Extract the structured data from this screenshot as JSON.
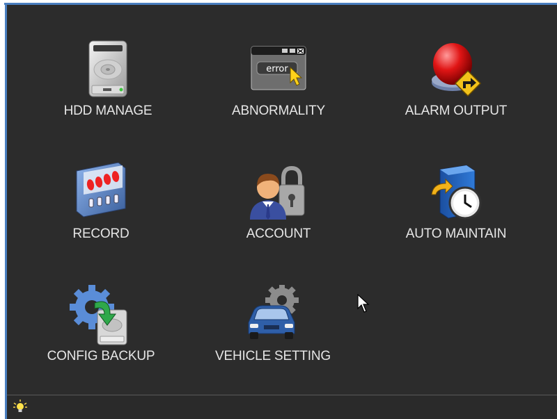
{
  "menu": {
    "items": [
      {
        "label": "HDD MANAGE",
        "icon": "hard-drive-icon"
      },
      {
        "label": "ABNORMALITY",
        "icon": "error-window-icon"
      },
      {
        "label": "ALARM OUTPUT",
        "icon": "alarm-light-icon"
      },
      {
        "label": "RECORD",
        "icon": "record-panel-icon"
      },
      {
        "label": "ACCOUNT",
        "icon": "user-lock-icon"
      },
      {
        "label": "AUTO MAINTAIN",
        "icon": "clock-server-icon"
      },
      {
        "label": "CONFIG BACKUP",
        "icon": "gear-backup-icon"
      },
      {
        "label": "VEHICLE SETTING",
        "icon": "car-gear-icon"
      }
    ]
  },
  "error_window": {
    "text": "error"
  },
  "status_bar": {
    "icon": "lightbulb-icon"
  },
  "colors": {
    "background": "#2c2c2c",
    "label": "#e6e6e6",
    "frame_accent": "#4a7fc0"
  }
}
